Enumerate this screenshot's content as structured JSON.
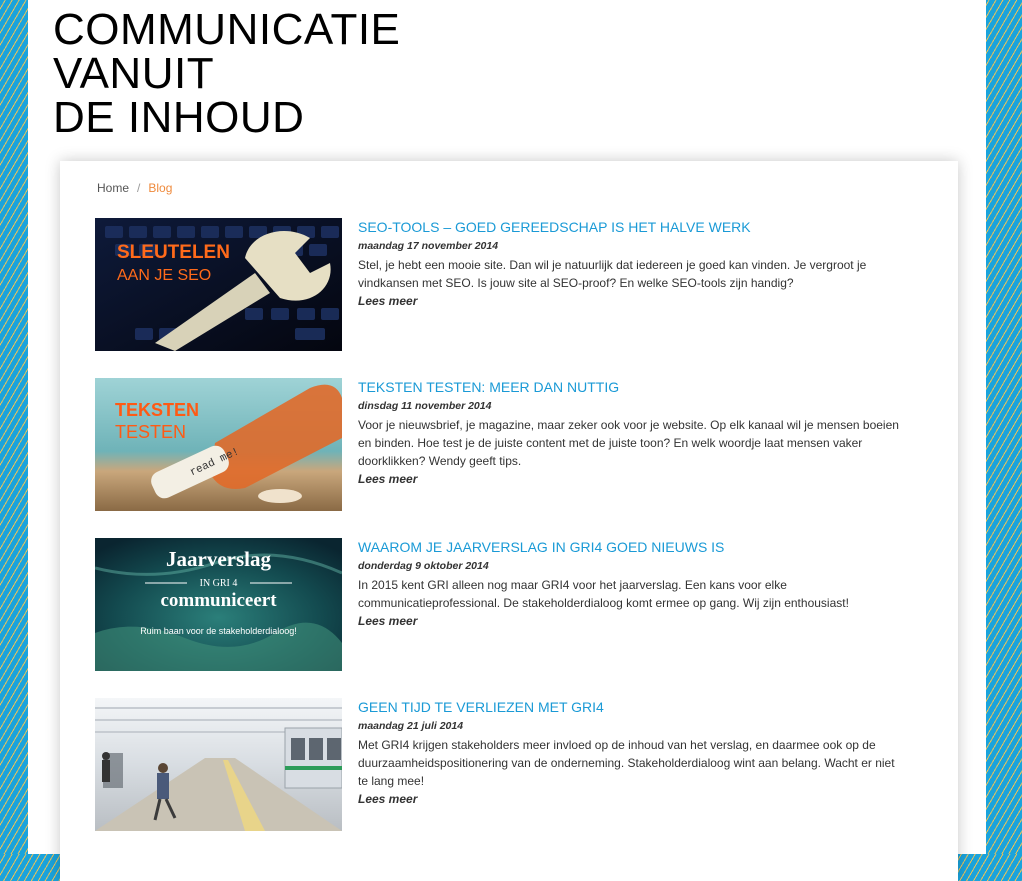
{
  "site": {
    "title_lines": [
      "COMMUNICATIE",
      "VANUIT",
      "DE INHOUD"
    ]
  },
  "breadcrumb": {
    "home": "Home",
    "separator": "/",
    "current": "Blog"
  },
  "posts": [
    {
      "title": "SEO-TOOLS – GOED GEREEDSCHAP IS HET HALVE WERK",
      "date": "maandag 17 november 2014",
      "excerpt": "Stel, je hebt een mooie site. Dan wil je natuurlijk dat iedereen je goed kan vinden. Je vergroot je vindkansen met SEO. Is jouw site al SEO-proof? En welke SEO-tools zijn handig?",
      "read_more": "Lees meer",
      "image_text": [
        "SLEUTELEN",
        "AAN JE SEO"
      ]
    },
    {
      "title": "TEKSTEN TESTEN: MEER DAN NUTTIG",
      "date": "dinsdag 11 november 2014",
      "excerpt": "Voor je nieuwsbrief, je magazine, maar zeker ook voor je website. Op elk kanaal wil je mensen boeien en binden. Hoe test je de juiste content met de juiste toon? En welk woordje laat mensen vaker doorklikken? Wendy geeft tips.",
      "read_more": "Lees meer",
      "image_text": [
        "TEKSTEN",
        "TESTEN",
        "read me!"
      ]
    },
    {
      "title": "WAAROM JE JAARVERSLAG IN GRI4 GOED NIEUWS IS",
      "date": "donderdag 9 oktober 2014",
      "excerpt": "In 2015 kent GRI alleen nog maar GRI4 voor het jaarverslag. Een kans voor elke communicatieprofessional. De stakeholderdialoog komt ermee op gang. Wij zijn enthousiast!",
      "read_more": "Lees meer",
      "image_text": [
        "Jaarverslag",
        "IN GRI 4",
        "communiceert",
        "Ruim baan voor de stakeholderdialoog!"
      ]
    },
    {
      "title": "GEEN TIJD TE VERLIEZEN MET GRI4",
      "date": "maandag 21 juli 2014",
      "excerpt": "Met GRI4 krijgen stakeholders meer invloed op de inhoud van het verslag, en daarmee ook op de duurzaamheidspositionering van de onderneming. Stakeholderdialoog wint aan belang. Wacht er niet te lang mee!",
      "read_more": "Lees meer"
    }
  ],
  "colors": {
    "accent_link": "#1a9ad6",
    "breadcrumb_current": "#ef8a3c",
    "background_stripe_blue": "#1aa3dc",
    "background_stripe_yellow": "#e9c25a"
  }
}
